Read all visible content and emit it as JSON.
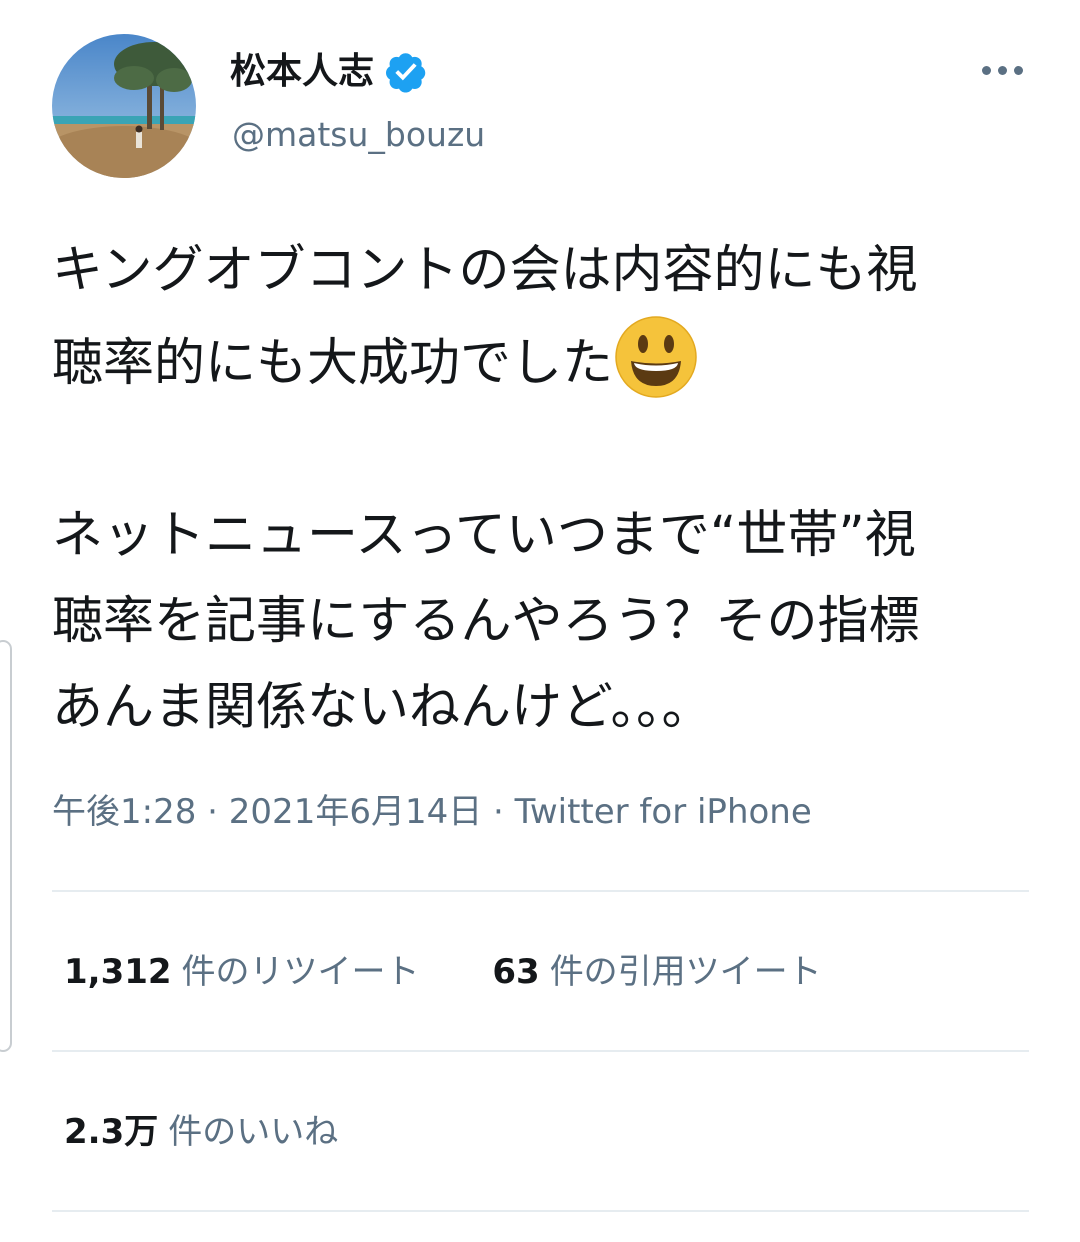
{
  "author": {
    "display_name": "松本人志",
    "handle": "@matsu_bouzu",
    "verified": true
  },
  "tweet": {
    "lines_para1": [
      "キングオブコントの会は内容的にも視",
      "聴率的にも大成功でした"
    ],
    "emoji": "smiling-face-with-open-mouth",
    "lines_para2": [
      "ネットニュースっていつまで“世帯”視",
      "聴率を記事にするんやろう？その指標",
      "あんま関係ないねんけど。。。"
    ]
  },
  "meta": {
    "time": "午後1:28",
    "sep": " · ",
    "date": "2021年6月14日",
    "source": "Twitter for iPhone"
  },
  "stats": {
    "retweets": {
      "count": "1,312",
      "label": "件のリツイート"
    },
    "quotes": {
      "count": "63",
      "label": "件の引用ツイート"
    },
    "likes": {
      "count": "2.3万",
      "label": "件のいいね"
    }
  },
  "colors": {
    "verified": "#1da1f2",
    "secondary_text": "#5b7083",
    "divider": "#e6ecf0"
  }
}
